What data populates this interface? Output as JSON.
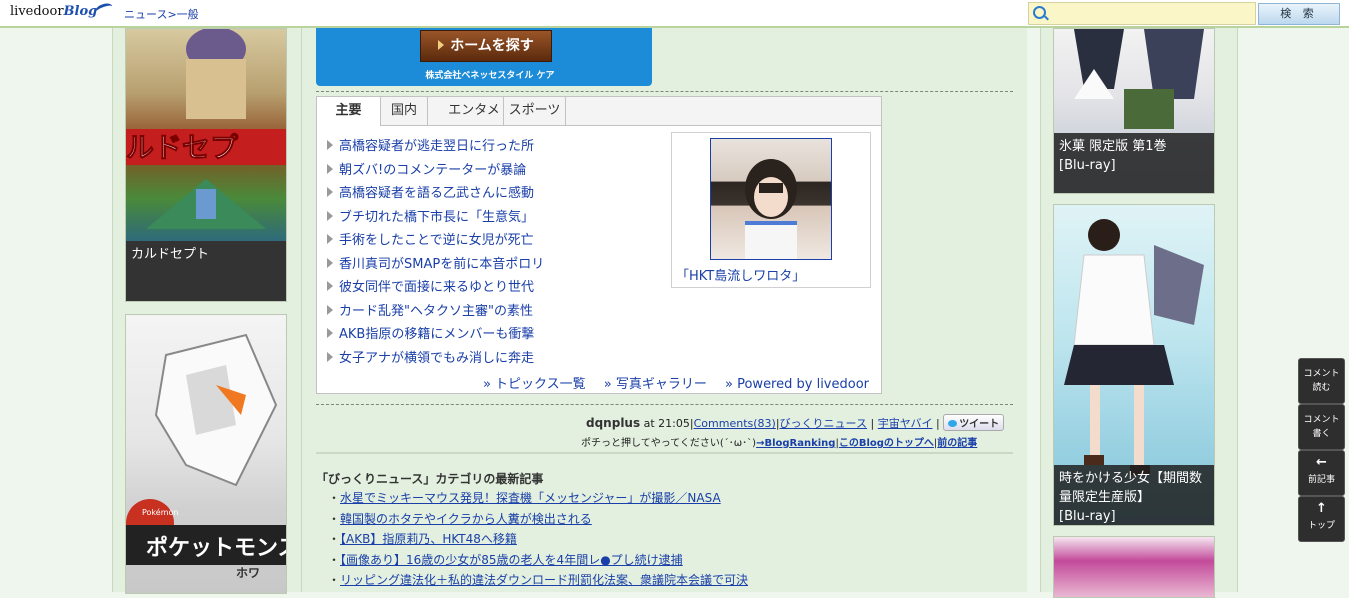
{
  "header": {
    "logo_text": "livedoor",
    "logo_blog": "Blog",
    "breadcrumb": "ニュース>一般",
    "search_placeholder": "",
    "search_button": "検 索"
  },
  "left_ads": [
    {
      "caption": "カルドセプト"
    },
    {
      "caption": ""
    }
  ],
  "left_ad_art_text": {
    "logo1": "ルドセプ",
    "pokemon_small": "Pokémon",
    "pokemon_logo": "ポケットモンス",
    "pokemon_sub": "ホワ"
  },
  "banner": {
    "button_label": "ホームを探す",
    "company": "株式会社ベネッセスタイル ケア"
  },
  "news": {
    "tabs": [
      "主要",
      "国内",
      "エンタメ",
      "スポーツ"
    ],
    "active_tab": 0,
    "topics": [
      "高橋容疑者が逃走翌日に行った所",
      "朝ズバ!のコメンテーターが暴論",
      "高橋容疑者を語る乙武さんに感動",
      "ブチ切れた橋下市長に「生意気」",
      "手術をしたことで逆に女児が死亡",
      "香川真司がSMAPを前に本音ポロリ",
      "彼女同伴で面接に来るゆとり世代",
      "カード乱発\"ヘタクソ主審\"の素性",
      "AKB指原の移籍にメンバーも衝撃",
      "女子アナが横領でもみ消しに奔走"
    ],
    "photo_caption": "「HKT島流しワロタ」",
    "footer_links": [
      "» トピックス一覧",
      "» 写真ギャラリー",
      "» Powered by livedoor"
    ]
  },
  "post_meta": {
    "author": "dqnplus",
    "time": "at 21:05",
    "comments": "Comments(83)",
    "category": "びっくりニュース",
    "tag": "宇宙ヤバイ",
    "tweet": "ツイート",
    "ranking_text": "ポチっと押してやってください(´･ω･`)",
    "ranking_link": "→BlogRanking",
    "top_link": "このBlogのトップへ",
    "prev_link": "前の記事"
  },
  "related": {
    "title": "「びっくりニュース」カテゴリの最新記事",
    "items": [
      "水星でミッキーマウス発見！探査機「メッセンジャー」が撮影／NASA",
      "韓国製のホタテやイクラから人糞が検出される",
      "【AKB】指原莉乃、HKT48へ移籍",
      "【画像あり】16歳の少女が85歳の老人を4年間レ●プし続け逮捕",
      "リッピング違法化＋私的違法ダウンロード刑罰化法案、衆議院本会議で可決"
    ]
  },
  "right_ads": [
    {
      "caption": "氷菓 限定版 第1巻\n[Blu-ray]"
    },
    {
      "caption": "時をかける少女【期間数量限定生産版】\n[Blu-ray]"
    },
    {
      "caption": ""
    }
  ],
  "side_buttons": [
    {
      "line1": "コメント",
      "line2": "読む"
    },
    {
      "line1": "コメント",
      "line2": "書く"
    },
    {
      "icon": "←",
      "line2": "前記事"
    },
    {
      "icon": "↑",
      "line2": "トップ"
    }
  ]
}
